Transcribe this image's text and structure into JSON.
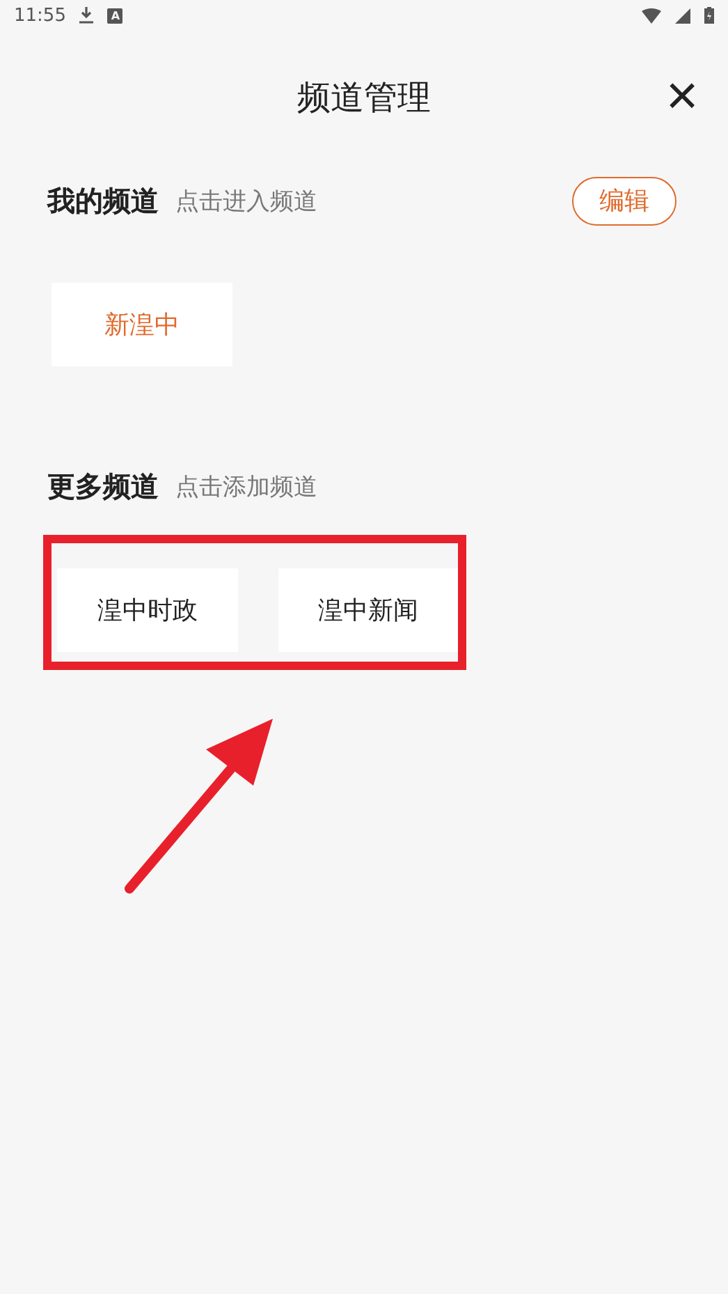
{
  "status_bar": {
    "time": "11:55",
    "badge": "A"
  },
  "header": {
    "title": "频道管理",
    "close": "×"
  },
  "my_channels": {
    "title": "我的频道",
    "hint": "点击进入频道",
    "edit_button": "编辑",
    "items": [
      {
        "label": "新湟中"
      }
    ]
  },
  "more_channels": {
    "title": "更多频道",
    "hint": "点击添加频道",
    "items": [
      {
        "label": "湟中时政"
      },
      {
        "label": "湟中新闻"
      }
    ]
  }
}
